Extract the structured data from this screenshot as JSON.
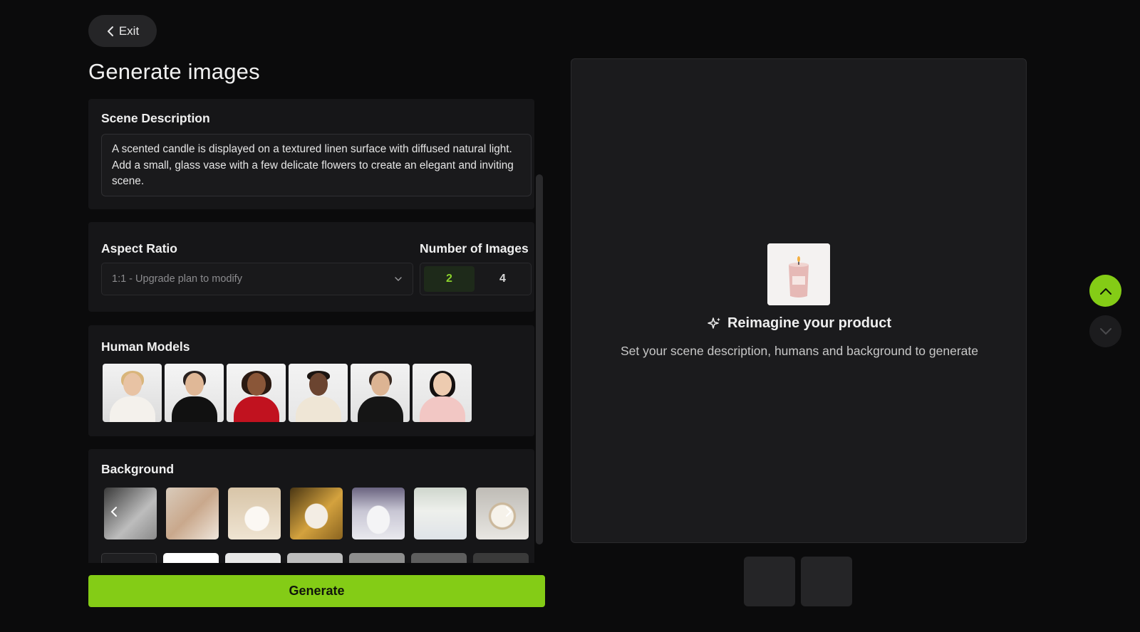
{
  "header": {
    "exit_label": "Exit",
    "title": "Generate images"
  },
  "scene": {
    "title": "Scene Description",
    "text": "A scented candle is displayed on a textured linen surface with diffused natural light. Add a small, glass vase with a few delicate flowers to create an elegant and inviting scene."
  },
  "aspect_ratio": {
    "title": "Aspect Ratio",
    "selected": "1:1 - Upgrade plan to modify"
  },
  "num_images": {
    "title": "Number of Images",
    "options": [
      "2",
      "4"
    ],
    "selected": "2"
  },
  "human_models": {
    "title": "Human Models"
  },
  "background": {
    "title": "Background"
  },
  "generate_label": "Generate",
  "preview": {
    "heading": "Reimagine your product",
    "subtext": "Set your scene description, humans and background to generate"
  },
  "colors": {
    "accent": "#84cc16",
    "surface": "#161618",
    "page": "#0b0b0c"
  }
}
